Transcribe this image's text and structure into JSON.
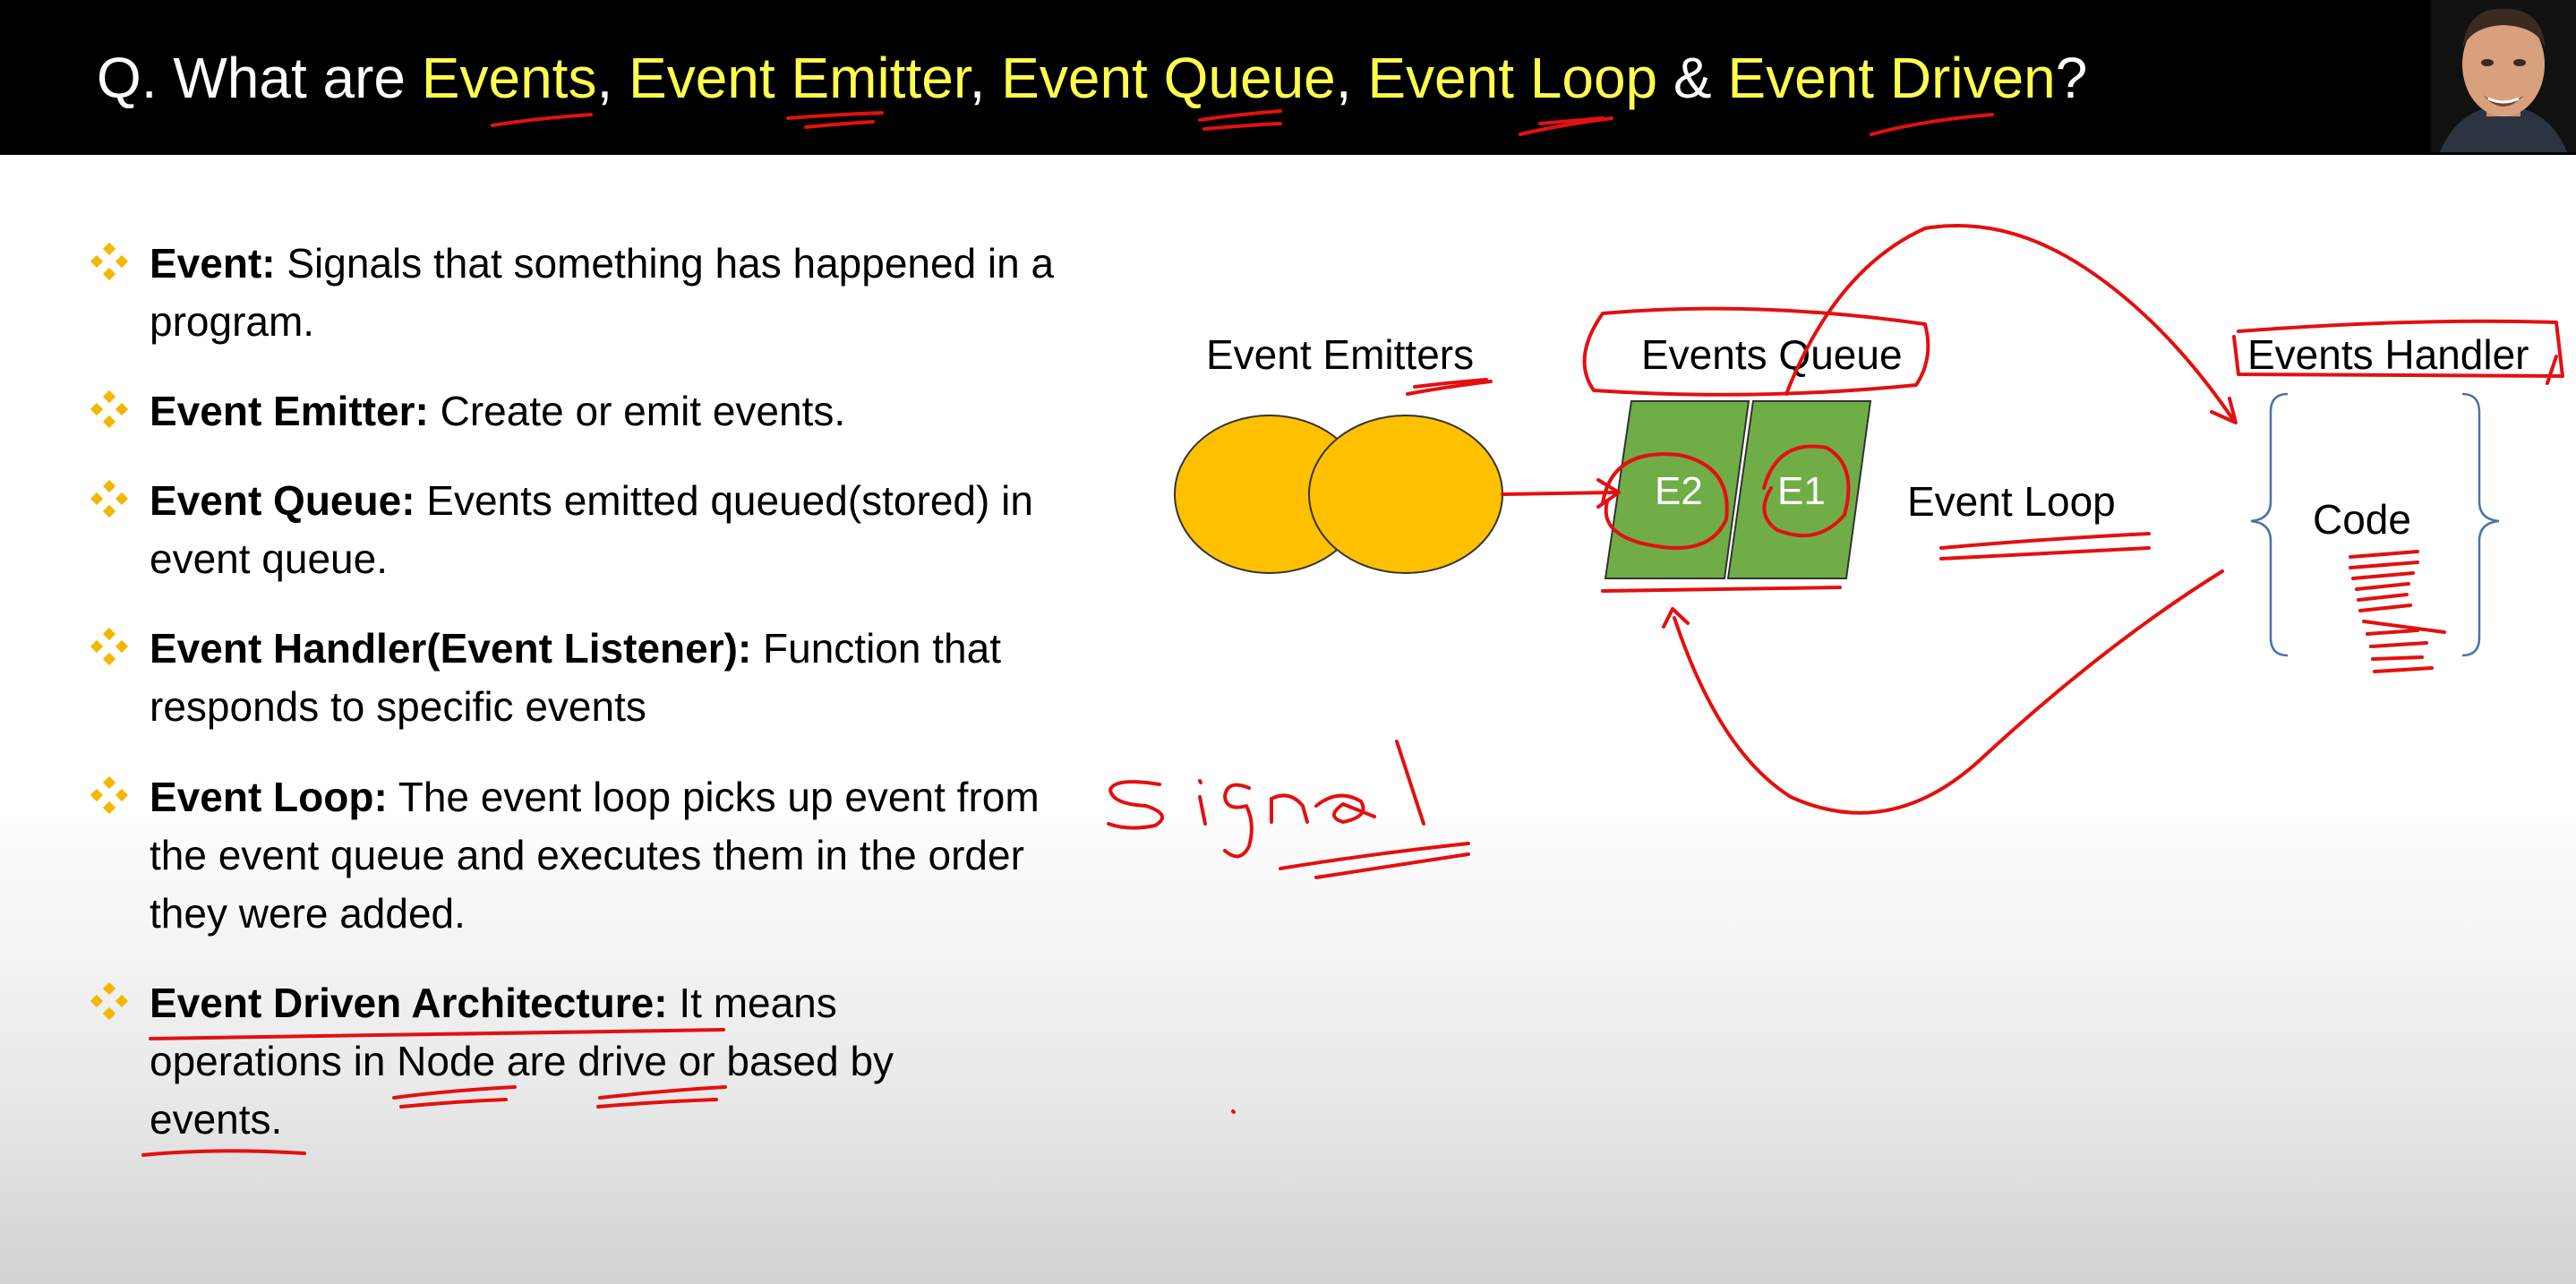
{
  "title": {
    "q": "Q. What are ",
    "t1": "Events",
    "c1": ", ",
    "t2": "Event Emitter",
    "c2": ", ",
    "t3": "Event Queue",
    "c3": ", ",
    "t4": "Event Loop",
    "amp": " & ",
    "t5": "Event Driven",
    "qm": "?"
  },
  "bullets": [
    {
      "term": "Event:",
      "text": " Signals that something has happened in a program."
    },
    {
      "term": "Event Emitter:",
      "text": " Create or emit events."
    },
    {
      "term": "Event Queue:",
      "text": " Events emitted queued(stored) in event queue."
    },
    {
      "term": "Event Handler(Event Listener):",
      "text": " Function that responds to specific events"
    },
    {
      "term": "Event Loop:",
      "text": " The event loop picks up event from the event queue and executes them in the order they were added."
    },
    {
      "term": "Event Driven Architecture:",
      "text": " It means operations in Node are drive or based by events."
    }
  ],
  "diagram": {
    "emitters_label": "Event Emitters",
    "queue_label": "Events Queue",
    "handler_label": "Events Handler",
    "loop_label": "Event Loop",
    "code_label": "Code",
    "queue_items": [
      "E2",
      "E1"
    ],
    "handwritten_note": "Signal"
  },
  "colors": {
    "title_highlight": "#ffff4d",
    "bullet_icon": "#f2b800",
    "emitter_fill": "#ffc000",
    "queue_fill": "#70ad47",
    "annotation_ink": "#e31010",
    "brace": "#4a73a8"
  }
}
